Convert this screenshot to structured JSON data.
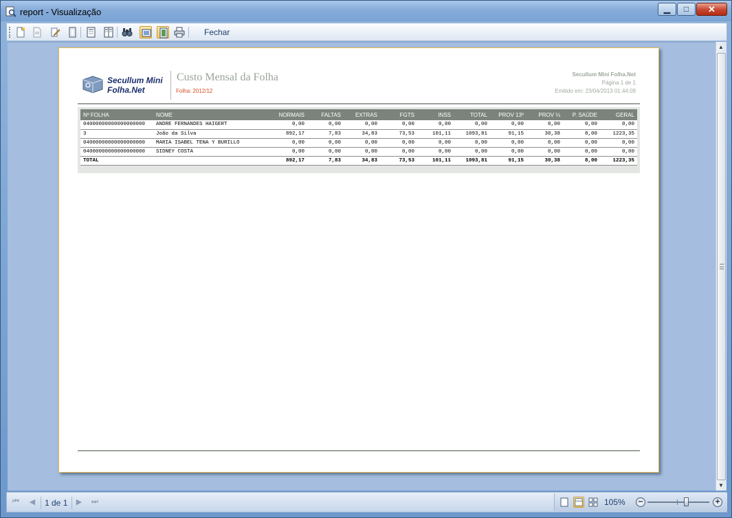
{
  "window": {
    "title": "report - Visualização",
    "controls": {
      "minimize": "▁",
      "maximize": "□",
      "close": "✕"
    }
  },
  "toolbar": {
    "buttons": [
      {
        "name": "new-icon"
      },
      {
        "name": "open-icon"
      },
      {
        "name": "edit-icon"
      },
      {
        "name": "page-setup-icon"
      },
      {
        "name": "header-footer-icon"
      },
      {
        "name": "columns-icon"
      },
      {
        "name": "find-icon"
      },
      {
        "name": "single-page-icon"
      },
      {
        "name": "two-page-icon"
      },
      {
        "name": "print-icon"
      }
    ],
    "close_label": "Fechar"
  },
  "report": {
    "brand_line1": "Secullum Mini",
    "brand_line2": "Folha.Net",
    "title": "Custo Mensal da Folha",
    "subtitle": "Folha: 2012/12",
    "company": "Secullum Mini Folha.Net",
    "page_info": "Página 1 de 1",
    "emitted": "Emitido em: 23/04/2013 01:44:09",
    "columns": [
      "Nº FOLHA",
      "NOME",
      "NORMAIS",
      "FALTAS",
      "EXTRAS",
      "FGTS",
      "INSS",
      "TOTAL",
      "PROV 13º",
      "PROV ⅓",
      "P. SAÚDE",
      "GERAL"
    ],
    "rows": [
      [
        "04000000000000000000",
        "ANDRE FERNANDES HAIGERT",
        "0,00",
        "0,00",
        "0,00",
        "0,00",
        "0,00",
        "0,00",
        "0,00",
        "0,00",
        "0,00",
        "0,00"
      ],
      [
        "3",
        "João da Silva",
        "892,17",
        "7,83",
        "34,83",
        "73,53",
        "101,11",
        "1093,81",
        "91,15",
        "30,38",
        "8,00",
        "1223,35"
      ],
      [
        "04000000000000000000",
        "MARIA ISABEL TENA Y BURILLO",
        "0,00",
        "0,00",
        "0,00",
        "0,00",
        "0,00",
        "0,00",
        "0,00",
        "0,00",
        "0,00",
        "0,00"
      ],
      [
        "04000000000000000000",
        "SIDNEY COSTA",
        "0,00",
        "0,00",
        "0,00",
        "0,00",
        "0,00",
        "0,00",
        "0,00",
        "0,00",
        "0,00",
        "0,00"
      ]
    ],
    "total_row": [
      "TOTAL",
      "",
      "892,17",
      "7,83",
      "34,83",
      "73,53",
      "101,11",
      "1093,81",
      "91,15",
      "30,38",
      "8,00",
      "1223,35"
    ]
  },
  "statusbar": {
    "page_indicator": "1 de 1",
    "zoom": "105%",
    "zoom_minus": "−",
    "zoom_plus": "+",
    "zoom_level_fraction": 0.62
  }
}
